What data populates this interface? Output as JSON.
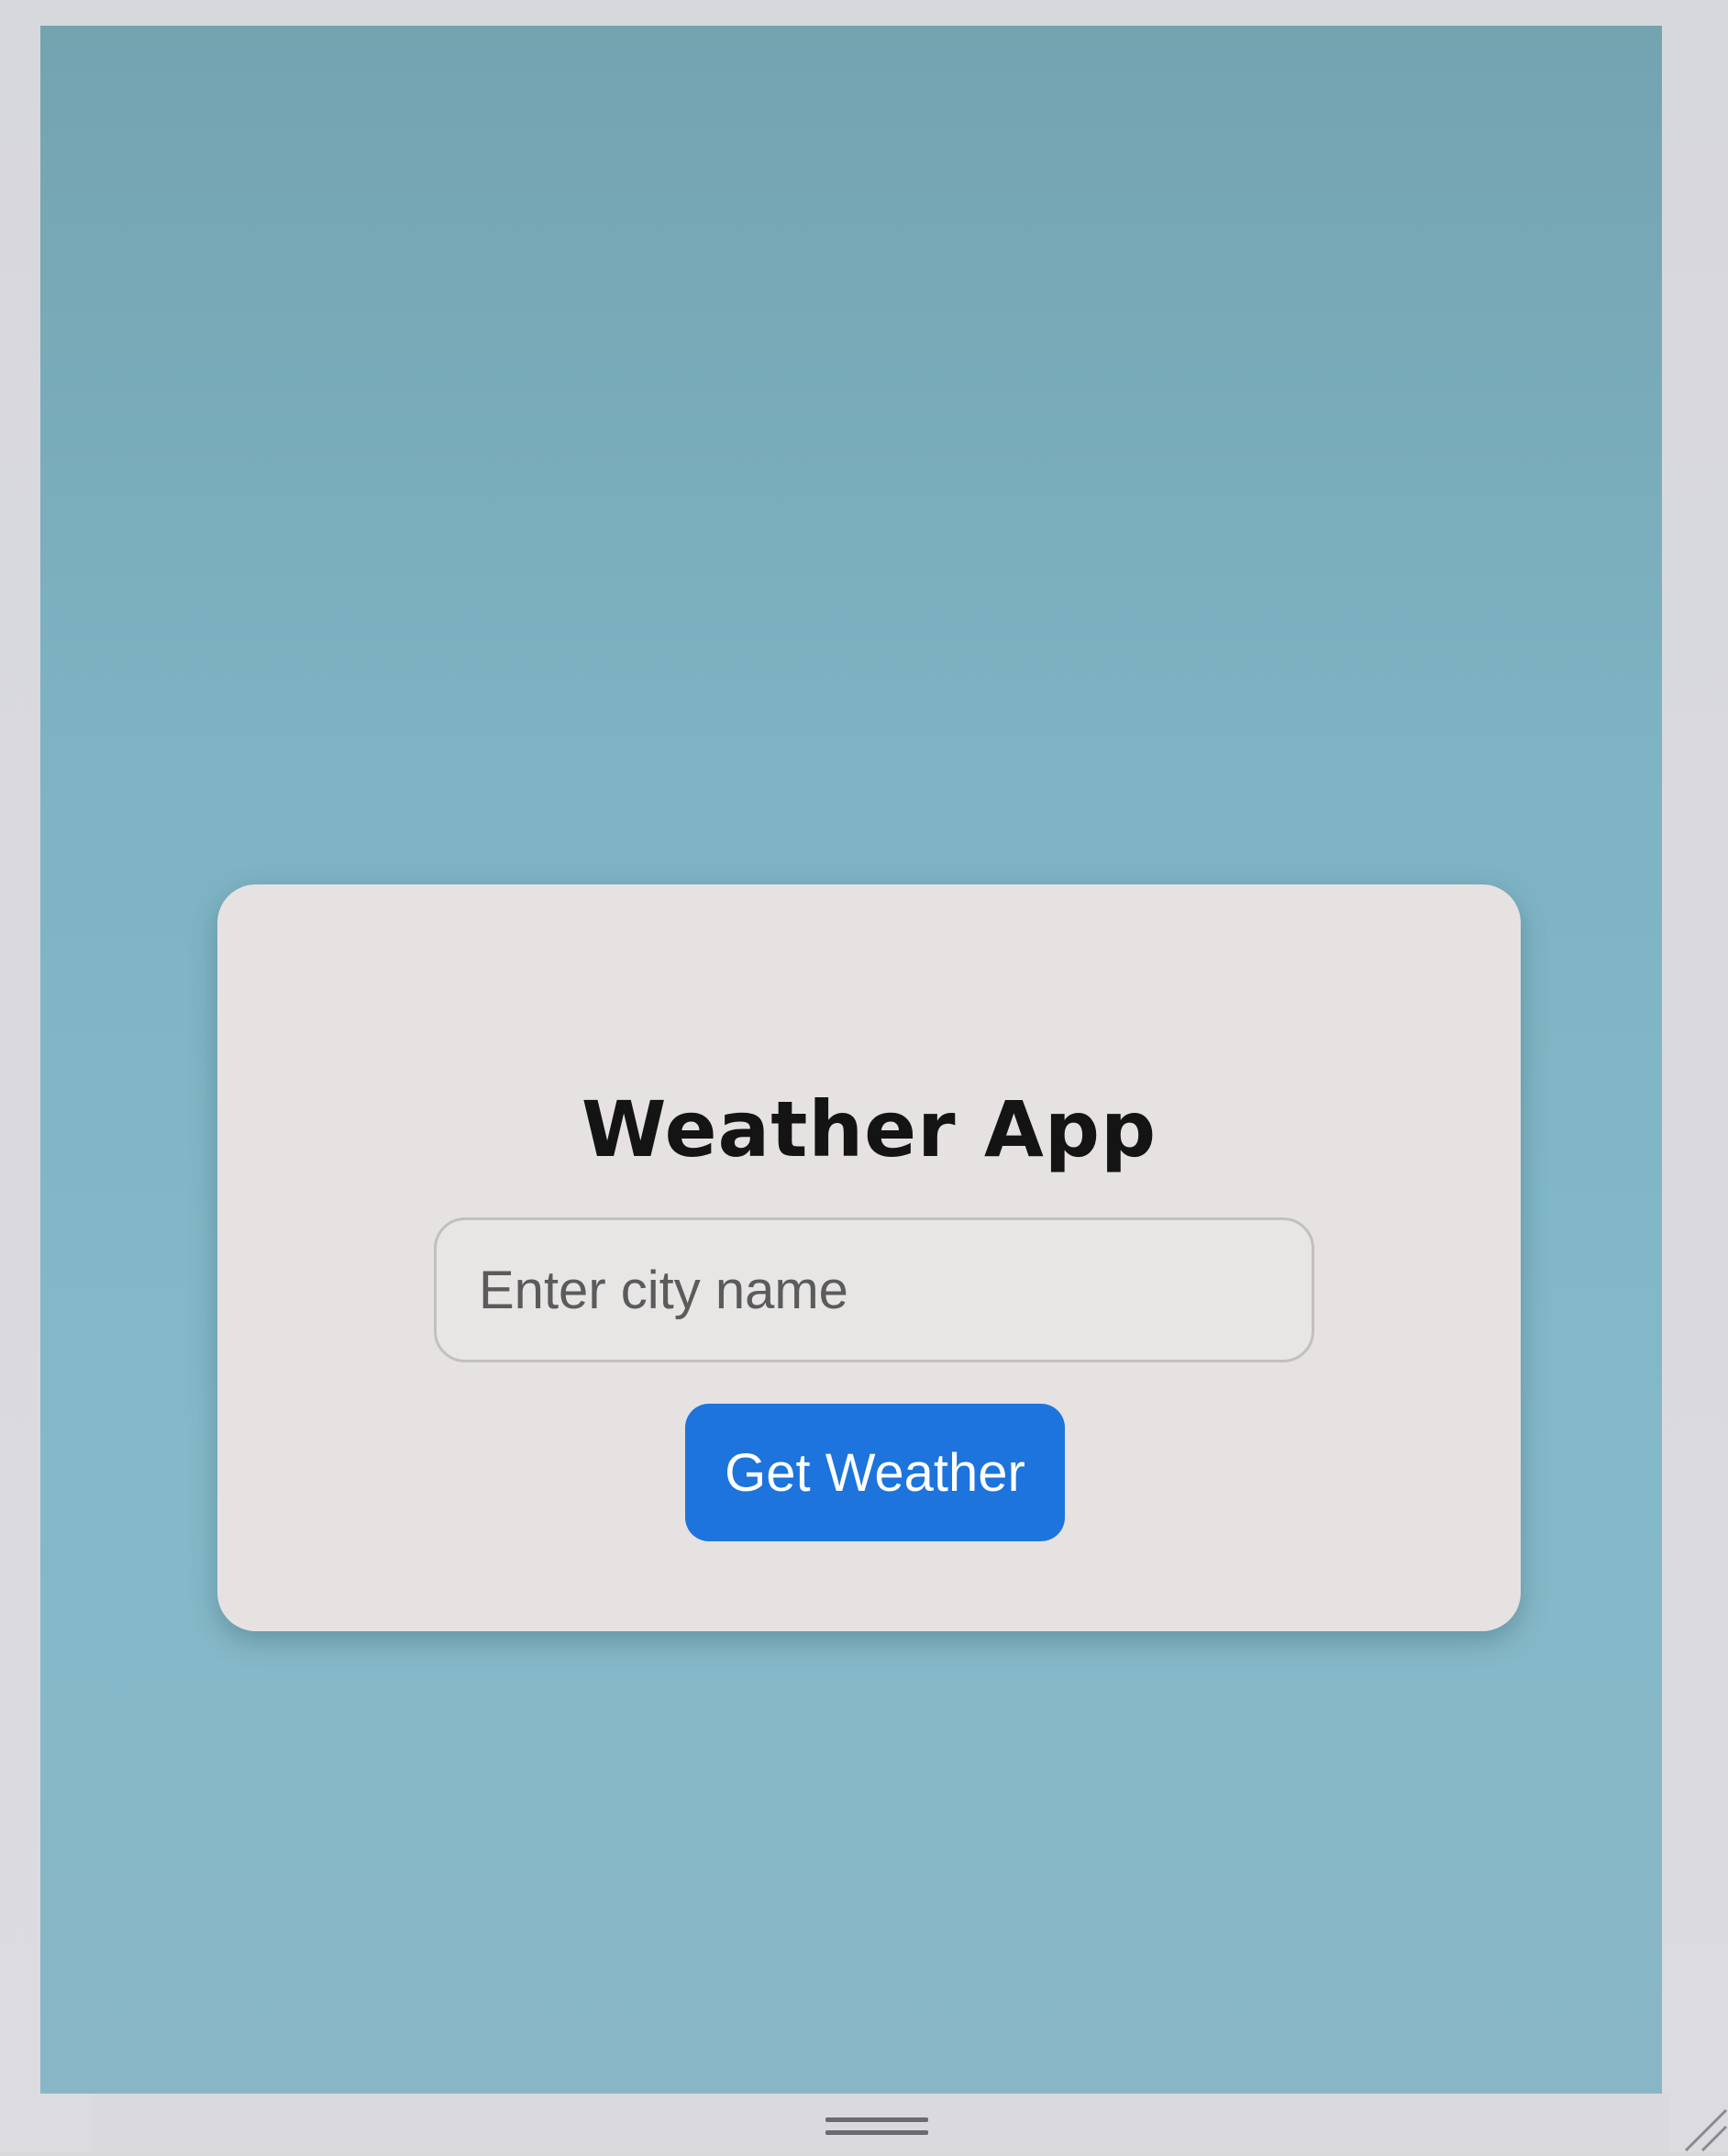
{
  "app": {
    "title": "Weather App"
  },
  "search": {
    "placeholder": "Enter city name",
    "value": ""
  },
  "actions": {
    "get_weather_label": "Get Weather"
  },
  "colors": {
    "background": "#7db3c3",
    "card": "#e6e2e2",
    "button": "#1c74dc",
    "button_text": "#ffffff",
    "title_text": "#141414"
  }
}
